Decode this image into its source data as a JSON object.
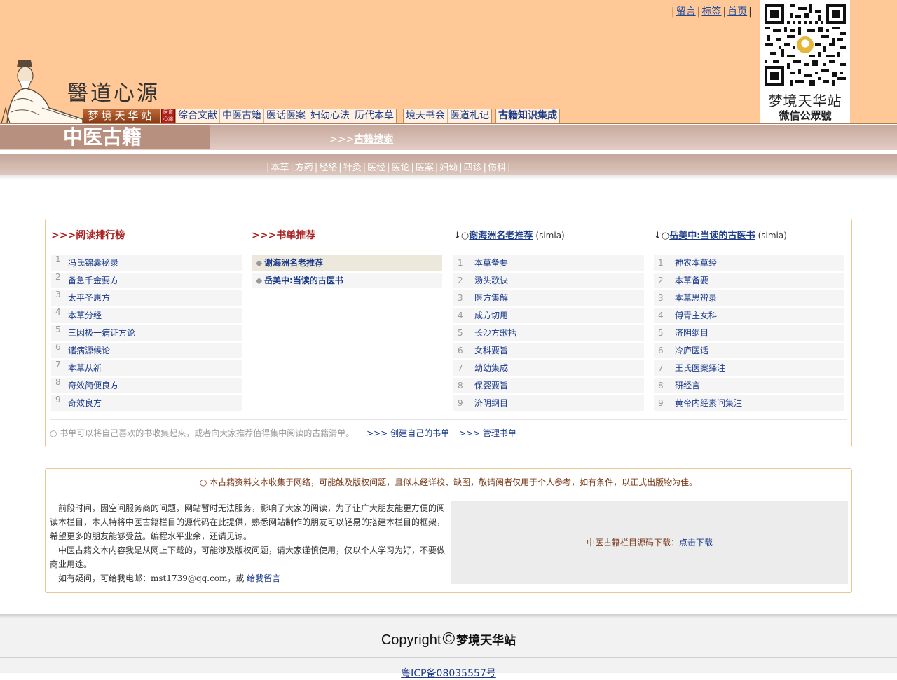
{
  "header": {
    "logo_text": "醫道心源",
    "site_name": "梦境天华站",
    "site_seal": "医道心源",
    "top_links": [
      "留言",
      "标签",
      "首页"
    ],
    "qr_caption_1": "梦境天华站",
    "qr_caption_2": "微信公眾號"
  },
  "nav": {
    "group1": [
      "综合文献",
      "中医古籍",
      "医话医案",
      "妇幼心法",
      "历代本草"
    ],
    "group2": [
      "境天书会",
      "医道札记"
    ],
    "group3": [
      "古籍知识集成"
    ]
  },
  "section": {
    "title": "中医古籍",
    "search_prefix": ">>>",
    "search_label": "古籍搜索"
  },
  "categories": [
    "本草",
    "方药",
    "经络",
    "针灸",
    "医经",
    "医论",
    "医案",
    "妇幼",
    "四诊",
    "伤科"
  ],
  "ranking": {
    "prefix": ">>>",
    "title": "阅读排行榜",
    "items": [
      "冯氏锦囊秘录",
      "备急千金要方",
      "太平圣惠方",
      "本草分经",
      "三因极一病证方论",
      "诸病源候论",
      "本草从新",
      "奇效简便良方",
      "奇效良方"
    ]
  },
  "recommend": {
    "prefix": ">>>",
    "title": "书单推荐",
    "items": [
      "谢海洲名老推荐",
      "岳美中:当读的古医书"
    ]
  },
  "list_xie": {
    "prefix": "↓○",
    "title": "谢海洲名老推荐",
    "suffix": "(simia)",
    "items": [
      "本草备要",
      "汤头歌诀",
      "医方集解",
      "成方切用",
      "长沙方歌括",
      "女科要旨",
      "幼幼集成",
      "保婴要旨",
      "济阴纲目"
    ]
  },
  "list_yue": {
    "prefix": "↓○",
    "title": "岳美中:当读的古医书",
    "suffix": "(simia)",
    "items": [
      "神农本草经",
      "本草备要",
      "本草思辨录",
      "傅青主女科",
      "济阴纲目",
      "冷庐医话",
      "王氏医案绎注",
      "研经言",
      "黄帝内经素问集注"
    ]
  },
  "booklist_footer": {
    "text": "○ 书单可以将自己喜欢的书收集起来，或者向大家推荐值得集中阅读的古籍清单。",
    "create_link": ">>> 创建自己的书单",
    "manage_link": ">>> 管理书单"
  },
  "info": {
    "notice": "○ 本古籍资料文本收集于网络，可能触及版权问题，且似未经详校、缺图，敬请阅者仅用于个人参考，如有条件，以正式出版物为佳。",
    "para1": "前段时间，因空间服务商的问题，网站暂时无法服务，影响了大家的阅读，为了让广大朋友能更方便的阅读本栏目，本人特将中医古籍栏目的源代码在此提供，熟悉网站制作的朋友可以轻易的搭建本栏目的框架，希望更多的朋友能够受益。编程水平业余，还请见谅。",
    "para2": "中医古籍文本内容我是从网上下载的，可能涉及版权问题，请大家谨慎使用，仅以个人学习为好，不要做商业用途。",
    "para3_prefix": "如有疑问，可给我电邮：mst1739@qq.com，或",
    "para3_link": "给我留言",
    "download_label": "中医古籍栏目源码下载：",
    "download_link": "点击下载"
  },
  "footer": {
    "copyright_word": "Copyright",
    "copyright_symbol": "©",
    "copyright_owner": "梦境天华站",
    "icp": "粤ICP备08035557号"
  }
}
